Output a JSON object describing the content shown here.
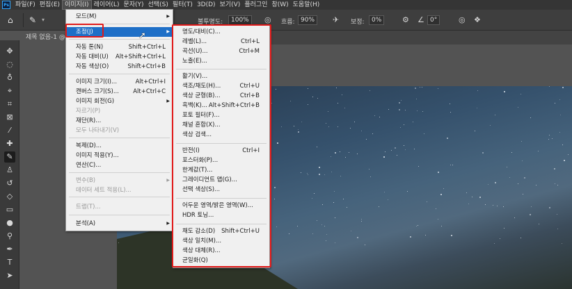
{
  "app": {
    "logo": "Ps"
  },
  "menubar": {
    "items": [
      "파일(F)",
      "편집(E)",
      "이미지(I)",
      "레이어(L)",
      "문자(Y)",
      "선택(S)",
      "필터(T)",
      "3D(D)",
      "보기(V)",
      "플러그인",
      "창(W)",
      "도움말(H)"
    ],
    "active_index": 2
  },
  "options": {
    "opacity_label": "불투명도:",
    "opacity_value": "100%",
    "flow_label": "흐름:",
    "flow_value": "90%",
    "smoothing_label": "보정:",
    "smoothing_value": "0%",
    "angle_value": "0°"
  },
  "document": {
    "tab_label": "제목 없음-1 @"
  },
  "image_menu": {
    "items": [
      {
        "label": "모드(M)",
        "shortcut": "",
        "submenu": true,
        "disabled": false
      },
      {
        "label": "조정(J)",
        "shortcut": "",
        "submenu": true,
        "disabled": false,
        "highlighted": true
      },
      {
        "label": "자동 톤(N)",
        "shortcut": "Shift+Ctrl+L",
        "disabled": false
      },
      {
        "label": "자동 대비(U)",
        "shortcut": "Alt+Shift+Ctrl+L",
        "disabled": false
      },
      {
        "label": "자동 색상(O)",
        "shortcut": "Shift+Ctrl+B",
        "disabled": false
      },
      {
        "label": "이미지 크기(I)...",
        "shortcut": "Alt+Ctrl+I",
        "disabled": false
      },
      {
        "label": "캔버스 크기(S)...",
        "shortcut": "Alt+Ctrl+C",
        "disabled": false
      },
      {
        "label": "이미지 회전(G)",
        "shortcut": "",
        "submenu": true,
        "disabled": false
      },
      {
        "label": "자르기(P)",
        "shortcut": "",
        "disabled": true
      },
      {
        "label": "재단(R)...",
        "shortcut": "",
        "disabled": false
      },
      {
        "label": "모두 나타내기(V)",
        "shortcut": "",
        "disabled": true
      },
      {
        "label": "복제(D)...",
        "shortcut": "",
        "disabled": false
      },
      {
        "label": "이미지 적용(Y)...",
        "shortcut": "",
        "disabled": false
      },
      {
        "label": "연산(C)...",
        "shortcut": "",
        "disabled": false
      },
      {
        "label": "변수(B)",
        "shortcut": "",
        "submenu": true,
        "disabled": true
      },
      {
        "label": "데이터 세트 적용(L)...",
        "shortcut": "",
        "disabled": true
      },
      {
        "label": "트랩(T)...",
        "shortcut": "",
        "disabled": true
      },
      {
        "label": "분석(A)",
        "shortcut": "",
        "submenu": true,
        "disabled": false
      }
    ]
  },
  "adjust_menu": {
    "items": [
      {
        "label": "명도/대비(C)...",
        "shortcut": ""
      },
      {
        "label": "레벨(L)...",
        "shortcut": "Ctrl+L"
      },
      {
        "label": "곡선(U)...",
        "shortcut": "Ctrl+M"
      },
      {
        "label": "노출(E)...",
        "shortcut": ""
      },
      {
        "label": "활기(V)...",
        "shortcut": ""
      },
      {
        "label": "색조/채도(H)...",
        "shortcut": "Ctrl+U"
      },
      {
        "label": "색상 균형(B)...",
        "shortcut": "Ctrl+B"
      },
      {
        "label": "흑백(K)...",
        "shortcut": "Alt+Shift+Ctrl+B"
      },
      {
        "label": "포토 필터(F)...",
        "shortcut": ""
      },
      {
        "label": "채널 혼합(X)...",
        "shortcut": ""
      },
      {
        "label": "색상 검색...",
        "shortcut": ""
      },
      {
        "label": "반전(I)",
        "shortcut": "Ctrl+I"
      },
      {
        "label": "포스터화(P)...",
        "shortcut": ""
      },
      {
        "label": "한계값(T)...",
        "shortcut": ""
      },
      {
        "label": "그레이디언트 맵(G)...",
        "shortcut": ""
      },
      {
        "label": "선택 색상(S)...",
        "shortcut": ""
      },
      {
        "label": "어두운 영역/밝은 영역(W)...",
        "shortcut": ""
      },
      {
        "label": "HDR 토닝...",
        "shortcut": ""
      },
      {
        "label": "채도 감소(D)",
        "shortcut": "Shift+Ctrl+U"
      },
      {
        "label": "색상 일치(M)...",
        "shortcut": ""
      },
      {
        "label": "색상 대체(R)...",
        "shortcut": ""
      },
      {
        "label": "균일화(Q)",
        "shortcut": ""
      }
    ]
  },
  "colors": {
    "highlight": "#1e6fc7",
    "annotation": "#e11919"
  }
}
